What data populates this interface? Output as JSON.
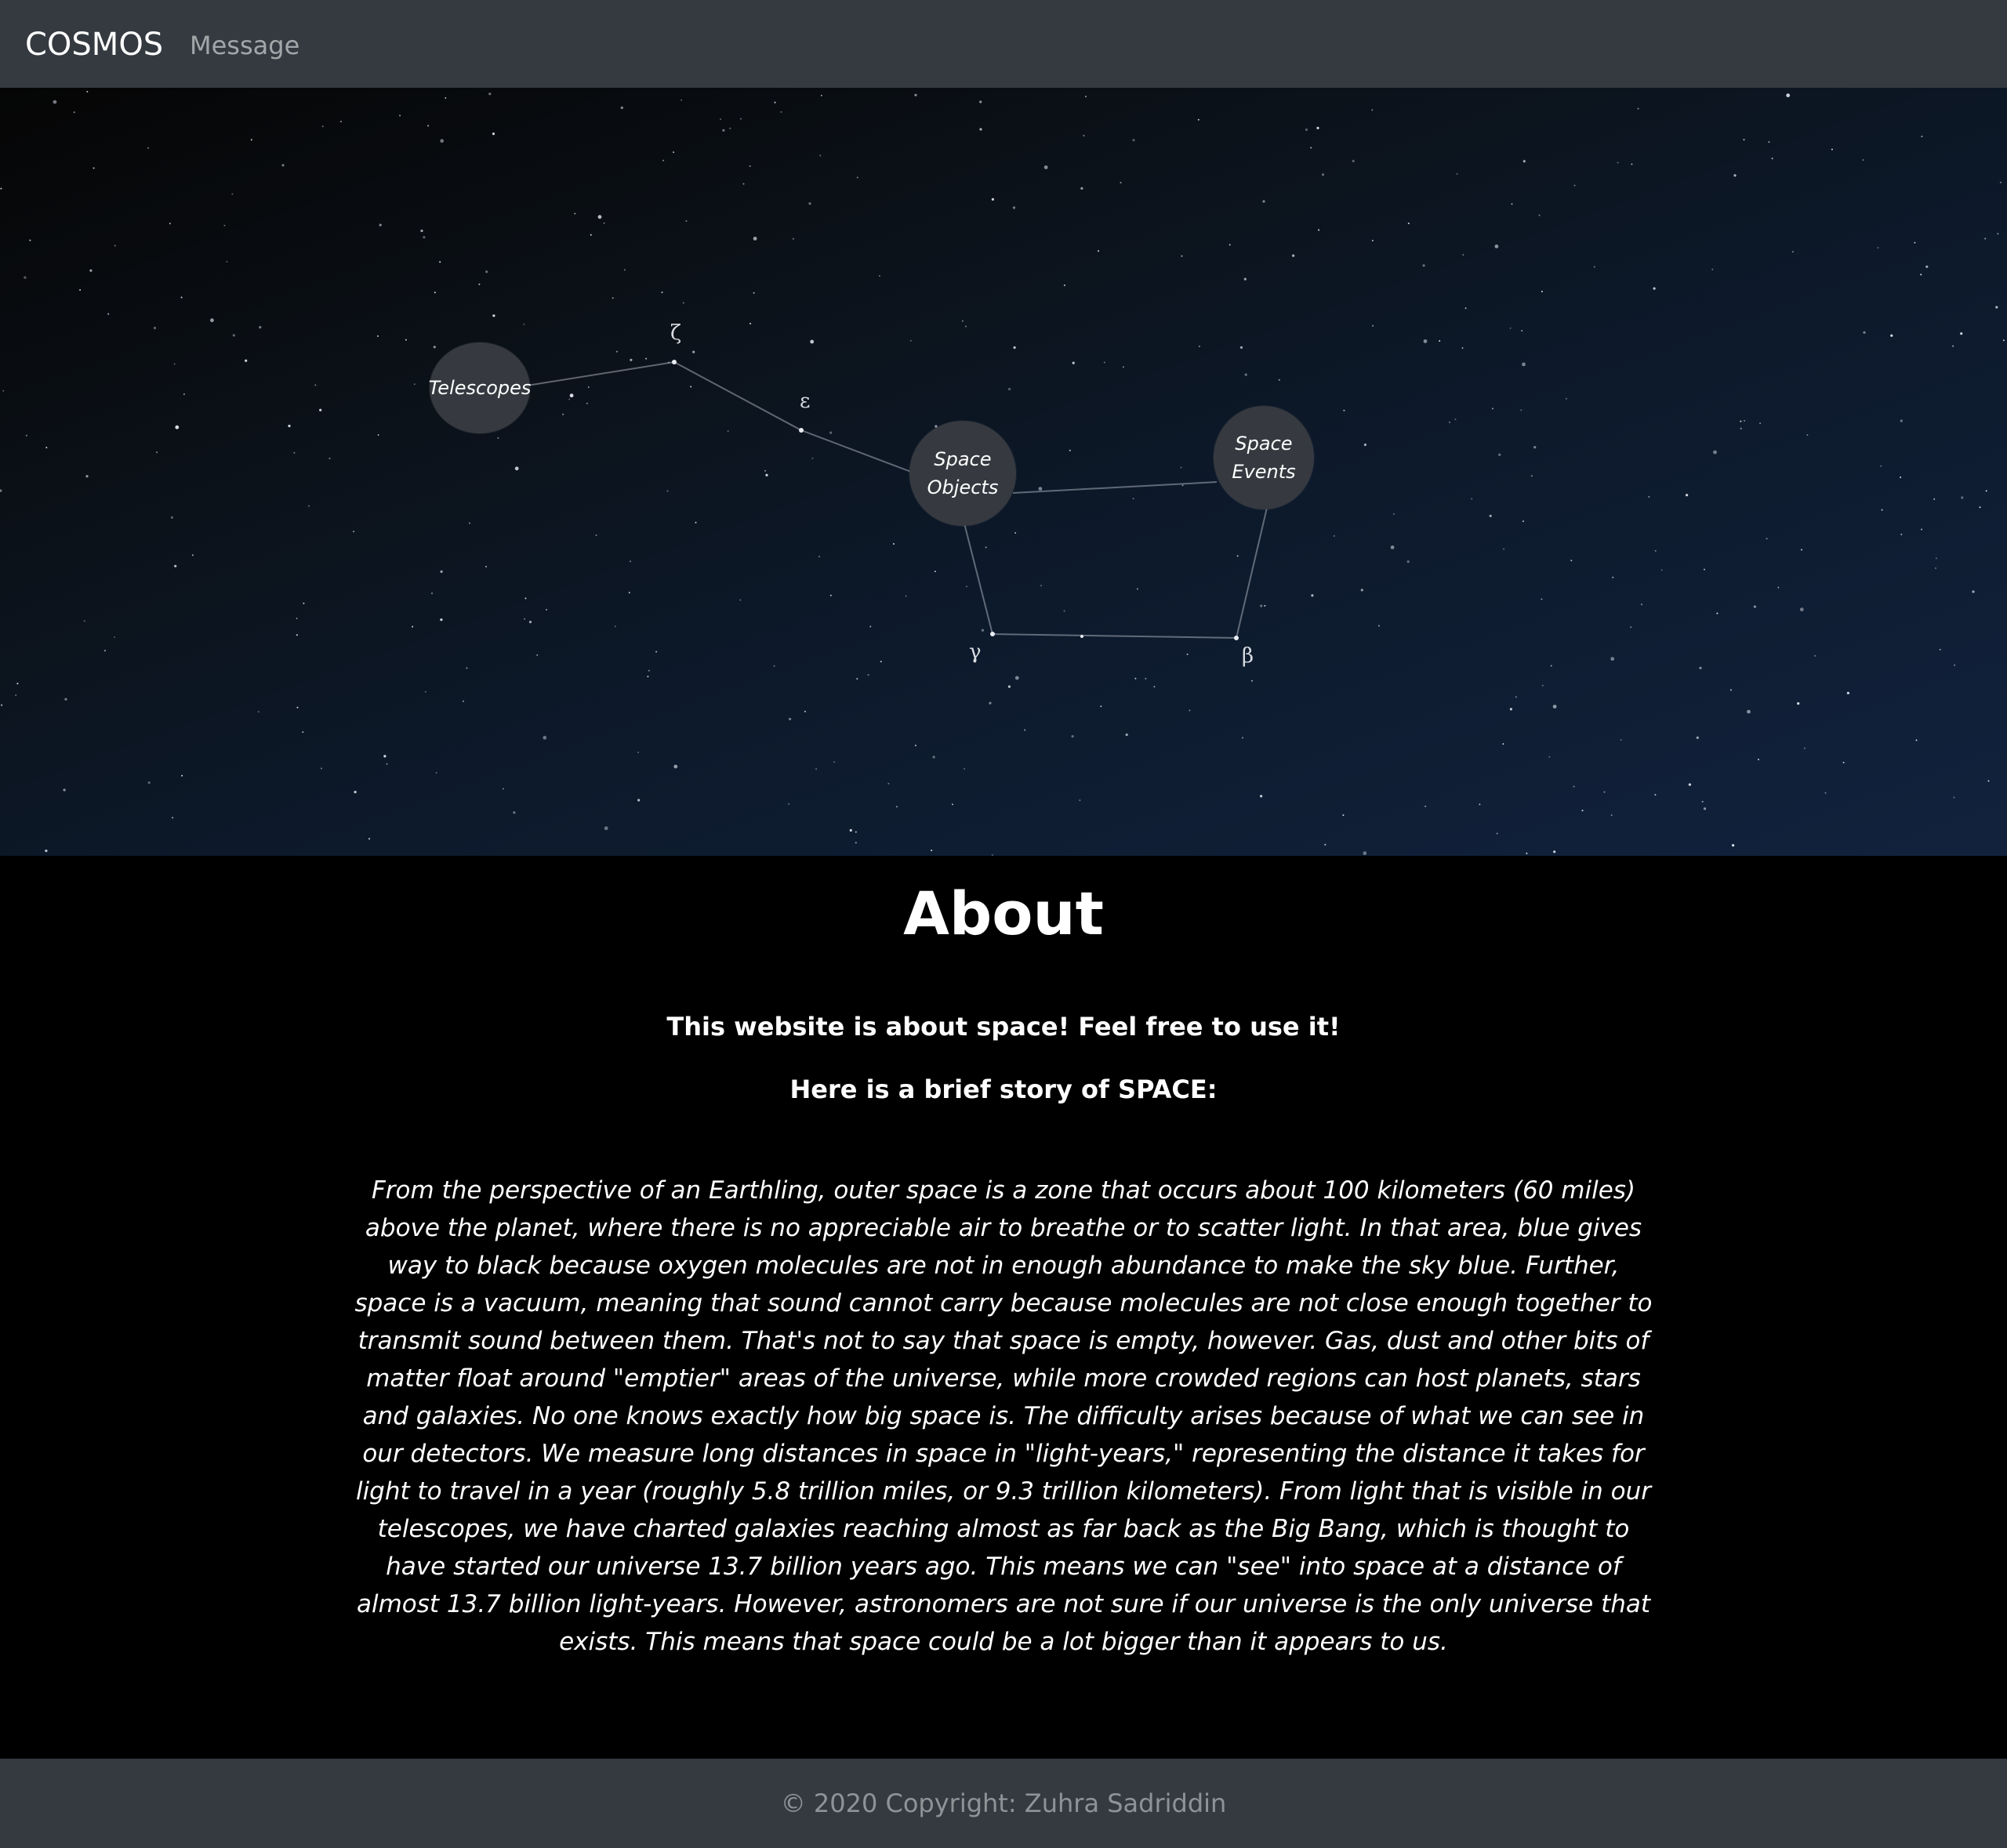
{
  "navbar": {
    "brand": "COSMOS",
    "links": [
      {
        "label": "Message"
      }
    ]
  },
  "hero": {
    "nodes": [
      {
        "label": "Telescopes"
      },
      {
        "label": "Space Objects"
      },
      {
        "label": "Space Events"
      }
    ],
    "greek_labels": [
      "ζ",
      "ε",
      "γ",
      "β"
    ]
  },
  "about": {
    "title": "About",
    "intro": "This website is about space! Feel free to use it!",
    "story_heading": "Here is a brief story of SPACE:",
    "story": "From the perspective of an Earthling, outer space is a zone that occurs about 100 kilometers (60 miles) above the planet, where there is no appreciable air to breathe or to scatter light. In that area, blue gives way to black because oxygen molecules are not in enough abundance to make the sky blue. Further, space is a vacuum, meaning that sound cannot carry because molecules are not close enough together to transmit sound between them. That's not to say that space is empty, however. Gas, dust and other bits of matter float around \"emptier\" areas of the universe, while more crowded regions can host planets, stars and galaxies. No one knows exactly how big space is. The difficulty arises because of what we can see in our detectors. We measure long distances in space in \"light-years,\" representing the distance it takes for light to travel in a year (roughly 5.8 trillion miles, or 9.3 trillion kilometers). From light that is visible in our telescopes, we have charted galaxies reaching almost as far back as the Big Bang, which is thought to have started our universe 13.7 billion years ago. This means we can \"see\" into space at a distance of almost 13.7 billion light-years. However, astronomers are not sure if our universe is the only universe that exists. This means that space could be a lot bigger than it appears to us."
  },
  "footer": {
    "copyright": "© 2020 Copyright: Zuhra Sadriddin"
  }
}
